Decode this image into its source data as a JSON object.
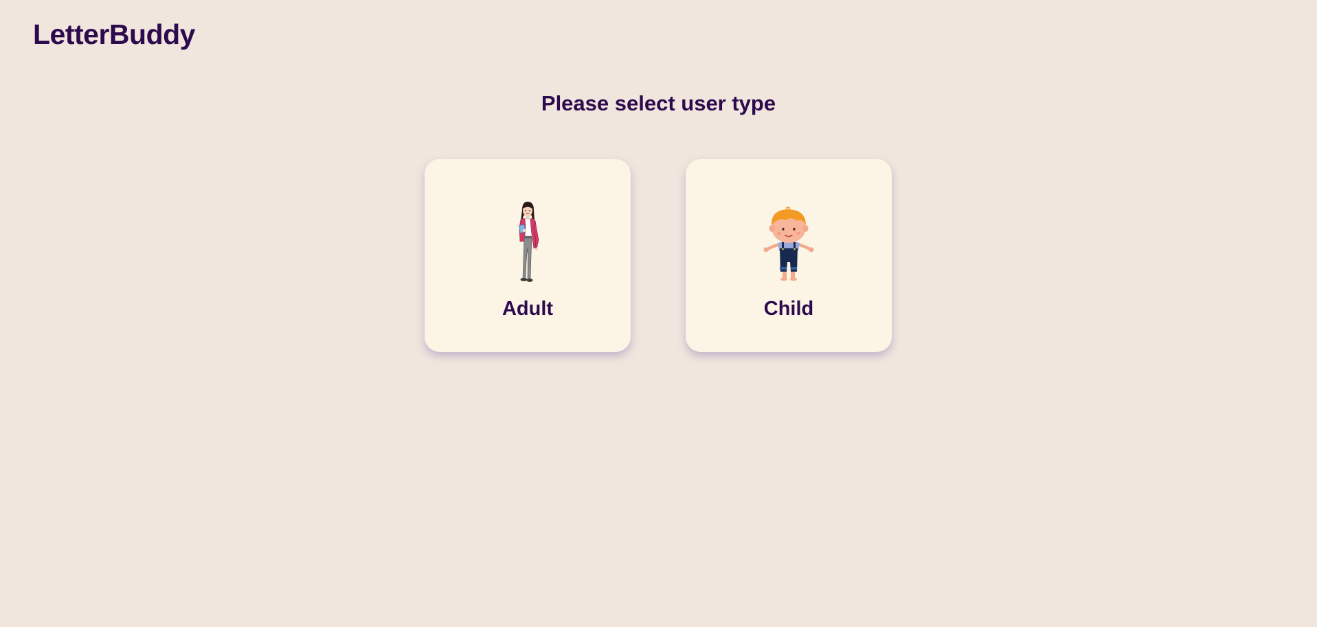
{
  "app": {
    "title": "LetterBuddy"
  },
  "prompt": "Please select user type",
  "cards": [
    {
      "label": "Adult",
      "icon": "adult-woman-icon"
    },
    {
      "label": "Child",
      "icon": "child-boy-icon"
    }
  ],
  "colors": {
    "background": "#f0e6dd",
    "card": "#fcf5e6",
    "text": "#2d0a4e",
    "shadow": "#b8acd8"
  }
}
